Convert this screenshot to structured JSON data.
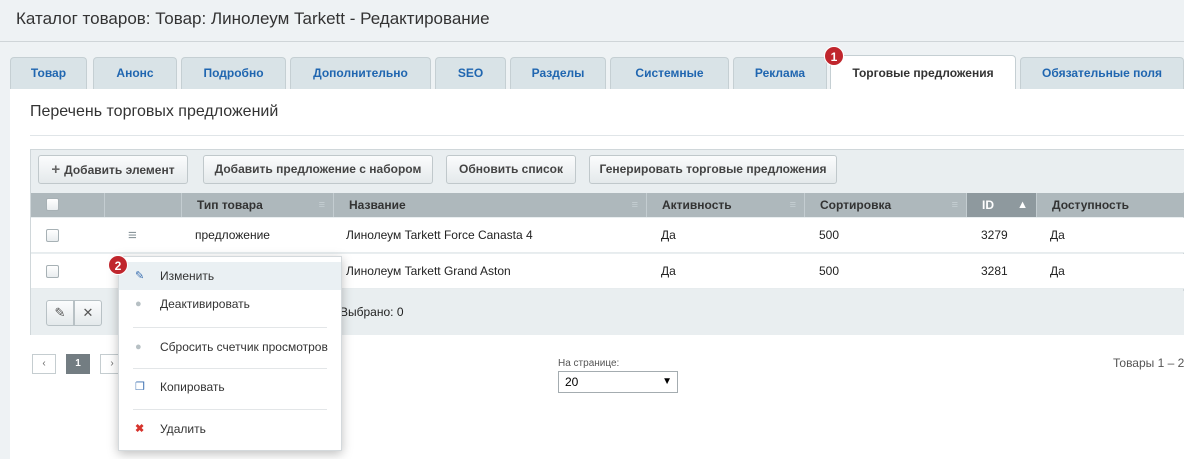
{
  "page_title": "Каталог товаров: Товар: Линолеум Tarkett - Редактирование",
  "tabs": [
    {
      "label": "Товар"
    },
    {
      "label": "Анонс"
    },
    {
      "label": "Подробно"
    },
    {
      "label": "Дополнительно"
    },
    {
      "label": "SEO"
    },
    {
      "label": "Разделы"
    },
    {
      "label": "Системные"
    },
    {
      "label": "Реклама"
    },
    {
      "label": "Торговые предложения"
    },
    {
      "label": "Обязательные поля"
    }
  ],
  "badges": {
    "first": "1",
    "second": "2"
  },
  "section_title": "Перечень торговых предложений",
  "toolbar": {
    "add_element": "Добавить элемент",
    "add_offer_set": "Добавить предложение с набором",
    "refresh": "Обновить список",
    "generate": "Генерировать торговые предложения"
  },
  "columns": [
    "Тип товара",
    "Название",
    "Активность",
    "Сортировка",
    "ID",
    "Доступность"
  ],
  "rows": [
    {
      "type": "предложение",
      "name": "Линолеум Tarkett Force Canasta 4",
      "active": "Да",
      "sort": "500",
      "id": "3279",
      "available": "Да"
    },
    {
      "type": "",
      "name": "Линолеум Tarkett Grand Aston",
      "active": "Да",
      "sort": "500",
      "id": "3281",
      "available": "Да"
    }
  ],
  "footer": {
    "selected": "Выбрано: 0"
  },
  "pager": {
    "current": "1",
    "per_page_label": "На странице:",
    "per_page_value": "20",
    "total": "Товары 1 – 2"
  },
  "context_menu": {
    "edit": "Изменить",
    "deactivate": "Деактивировать",
    "reset_views": "Сбросить счетчик просмотров",
    "copy": "Копировать",
    "delete": "Удалить"
  },
  "colors": {
    "tab_link": "#2066b0",
    "badge": "#c0262d",
    "header_bg": "#aeb8bc"
  }
}
